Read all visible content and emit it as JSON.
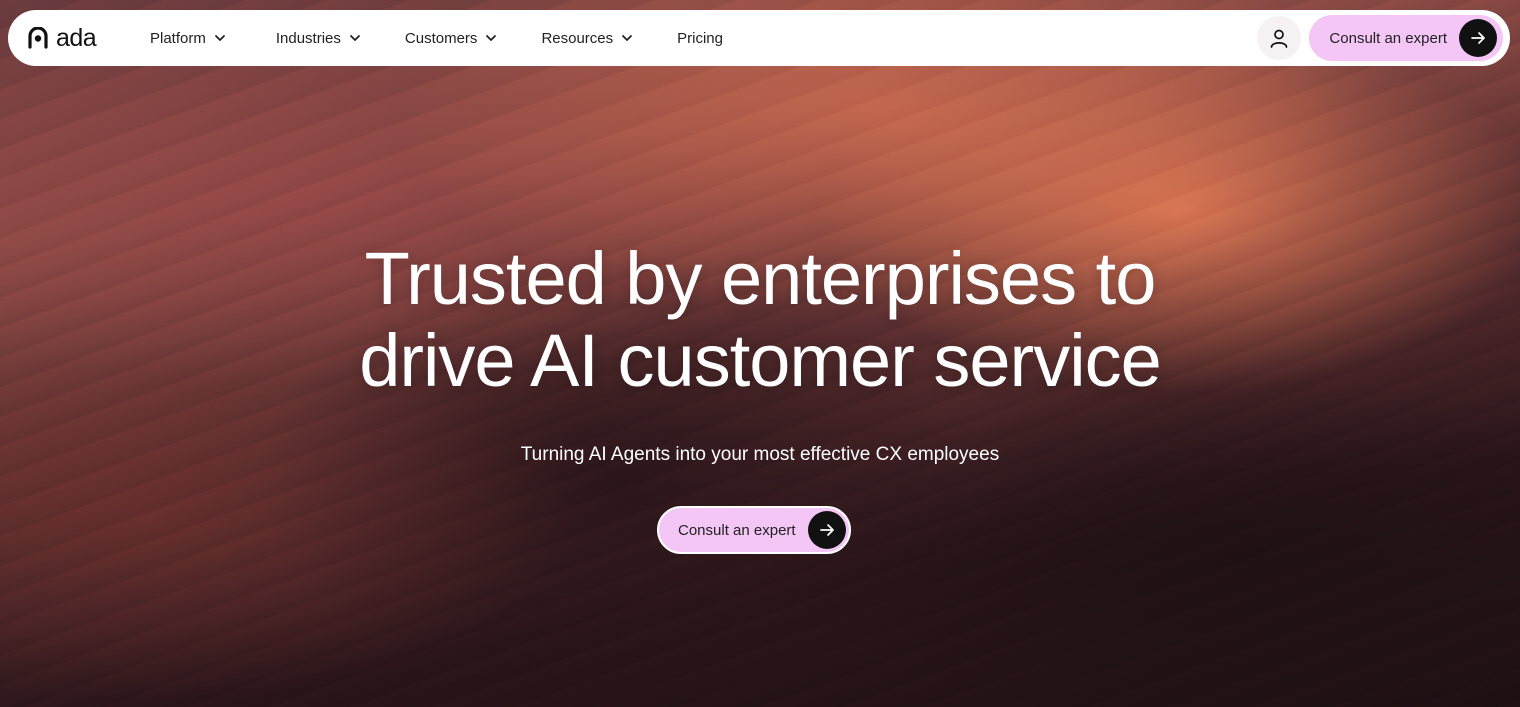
{
  "brand": {
    "name": "ada"
  },
  "nav": {
    "items": [
      {
        "label": "Platform"
      },
      {
        "label": "Industries"
      },
      {
        "label": "Customers"
      },
      {
        "label": "Resources"
      },
      {
        "label": "Pricing"
      }
    ],
    "cta_label": "Consult an expert"
  },
  "hero": {
    "title_line1": "Trusted by enterprises to",
    "title_line2": "drive AI customer service",
    "subtitle": "Turning AI Agents into your most effective CX employees",
    "cta_label": "Consult an expert"
  },
  "colors": {
    "cta_bg": "#f4c6f5",
    "cta_arrow_bg": "#111111",
    "nav_bg": "#ffffff"
  },
  "icons": {
    "logo": "ada-logo-icon",
    "chevron": "chevron-down-icon",
    "account": "user-icon",
    "arrow": "arrow-right-icon"
  }
}
